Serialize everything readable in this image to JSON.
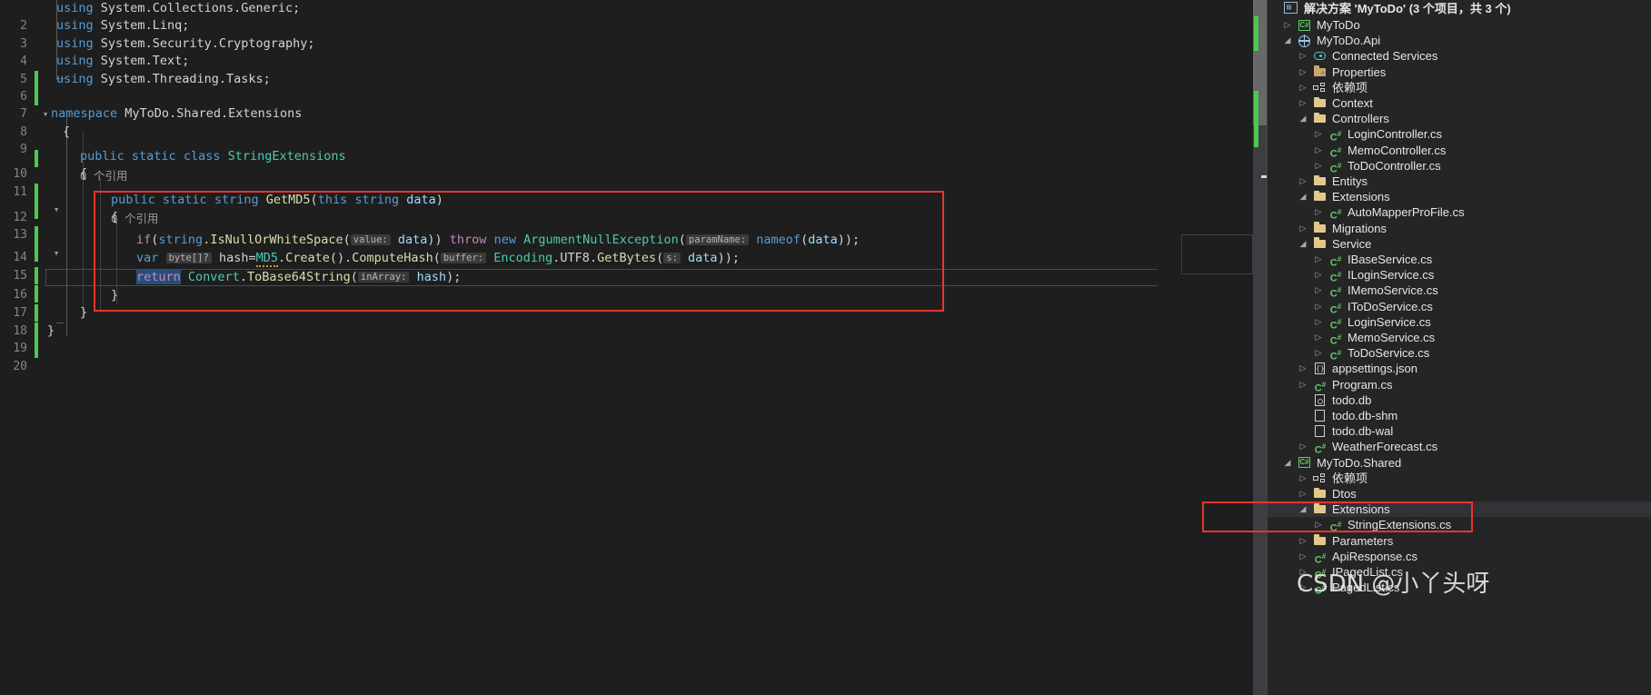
{
  "editor": {
    "first_line_number": 2,
    "lines": [
      {
        "n": 2,
        "changed": false,
        "text": "using System.Collections.Generic;"
      },
      {
        "n": 3,
        "changed": false,
        "text": "using System.Linq;"
      },
      {
        "n": 4,
        "changed": true,
        "text": "using System.Security.Cryptography;"
      },
      {
        "n": 5,
        "changed": true,
        "text": "using System.Text;"
      },
      {
        "n": 6,
        "changed": false,
        "text": "using System.Threading.Tasks;"
      },
      {
        "n": 7,
        "changed": false,
        "text": ""
      },
      {
        "n": 8,
        "changed": false,
        "text": "namespace MyToDo.Shared.Extensions"
      },
      {
        "n": 9,
        "changed": false,
        "text": "{"
      },
      {
        "n": "",
        "changed": true,
        "text": "0 个引用"
      },
      {
        "n": 10,
        "changed": true,
        "text": "public static class StringExtensions"
      },
      {
        "n": 11,
        "changed": true,
        "text": "{"
      },
      {
        "n": "",
        "changed": true,
        "text": "0 个引用"
      },
      {
        "n": 12,
        "changed": true,
        "text": "public static string GetMD5(this string data)"
      },
      {
        "n": 13,
        "changed": true,
        "text": "{"
      },
      {
        "n": 14,
        "changed": true,
        "text": "if(string.IsNullOrWhiteSpace(value: data)) throw new ArgumentNullException(paramName: nameof(data));"
      },
      {
        "n": 15,
        "changed": true,
        "text": "var byte[]? hash=MD5.Create().ComputeHash(buffer: Encoding.UTF8.GetBytes(s: data));"
      },
      {
        "n": 16,
        "changed": true,
        "text": "return Convert.ToBase64String(inArray: hash);"
      },
      {
        "n": 17,
        "changed": true,
        "text": "}"
      },
      {
        "n": 18,
        "changed": true,
        "text": "}"
      },
      {
        "n": 19,
        "changed": false,
        "text": "}"
      },
      {
        "n": 20,
        "changed": false,
        "text": ""
      }
    ],
    "reference_hint": "0 个引用",
    "current_line": 16,
    "selected_token": "return",
    "inline_hints": [
      "value:",
      "paramName:",
      "buffer:",
      "s:",
      "inArray:"
    ],
    "nullable_type_hint": "byte[]?",
    "red_highlight": "GetMD5 method body"
  },
  "explorer": {
    "solution_title": "解决方案 'MyToDo' (3 个项目，共 3 个)",
    "solution_icon": "solution-icon",
    "tree": [
      {
        "indent": 0,
        "arrow": "closed",
        "icon": "csproj",
        "label": "MyToDo"
      },
      {
        "indent": 0,
        "arrow": "open",
        "icon": "web",
        "label": "MyToDo.Api"
      },
      {
        "indent": 1,
        "arrow": "closed",
        "icon": "cloud",
        "label": "Connected Services"
      },
      {
        "indent": 1,
        "arrow": "closed",
        "icon": "props",
        "label": "Properties"
      },
      {
        "indent": 1,
        "arrow": "closed",
        "icon": "deps",
        "label": "依赖项"
      },
      {
        "indent": 1,
        "arrow": "closed",
        "icon": "folder",
        "label": "Context"
      },
      {
        "indent": 1,
        "arrow": "open",
        "icon": "folder",
        "label": "Controllers"
      },
      {
        "indent": 2,
        "arrow": "closed",
        "icon": "cs",
        "label": "LoginController.cs"
      },
      {
        "indent": 2,
        "arrow": "closed",
        "icon": "cs",
        "label": "MemoController.cs"
      },
      {
        "indent": 2,
        "arrow": "closed",
        "icon": "cs",
        "label": "ToDoController.cs"
      },
      {
        "indent": 1,
        "arrow": "closed",
        "icon": "folder",
        "label": "Entitys"
      },
      {
        "indent": 1,
        "arrow": "open",
        "icon": "folder",
        "label": "Extensions"
      },
      {
        "indent": 2,
        "arrow": "closed",
        "icon": "cs",
        "label": "AutoMapperProFile.cs"
      },
      {
        "indent": 1,
        "arrow": "closed",
        "icon": "folder",
        "label": "Migrations"
      },
      {
        "indent": 1,
        "arrow": "open",
        "icon": "folder",
        "label": "Service"
      },
      {
        "indent": 2,
        "arrow": "closed",
        "icon": "cs",
        "label": "IBaseService.cs"
      },
      {
        "indent": 2,
        "arrow": "closed",
        "icon": "cs",
        "label": "ILoginService.cs"
      },
      {
        "indent": 2,
        "arrow": "closed",
        "icon": "cs",
        "label": "IMemoService.cs"
      },
      {
        "indent": 2,
        "arrow": "closed",
        "icon": "cs",
        "label": "IToDoService.cs"
      },
      {
        "indent": 2,
        "arrow": "closed",
        "icon": "cs",
        "label": "LoginService.cs"
      },
      {
        "indent": 2,
        "arrow": "closed",
        "icon": "cs",
        "label": "MemoService.cs"
      },
      {
        "indent": 2,
        "arrow": "closed",
        "icon": "cs",
        "label": "ToDoService.cs"
      },
      {
        "indent": 1,
        "arrow": "closed",
        "icon": "json",
        "label": "appsettings.json"
      },
      {
        "indent": 1,
        "arrow": "closed",
        "icon": "cs",
        "label": "Program.cs"
      },
      {
        "indent": 1,
        "arrow": "none",
        "icon": "db",
        "label": "todo.db"
      },
      {
        "indent": 1,
        "arrow": "none",
        "icon": "file",
        "label": "todo.db-shm"
      },
      {
        "indent": 1,
        "arrow": "none",
        "icon": "file",
        "label": "todo.db-wal"
      },
      {
        "indent": 1,
        "arrow": "closed",
        "icon": "cs",
        "label": "WeatherForecast.cs"
      },
      {
        "indent": 0,
        "arrow": "open",
        "icon": "csproj",
        "label": "MyToDo.Shared"
      },
      {
        "indent": 1,
        "arrow": "closed",
        "icon": "deps",
        "label": "依赖项"
      },
      {
        "indent": 1,
        "arrow": "closed",
        "icon": "folder",
        "label": "Dtos"
      },
      {
        "indent": 1,
        "arrow": "open",
        "icon": "folder",
        "label": "Extensions",
        "highlight": true
      },
      {
        "indent": 2,
        "arrow": "closed",
        "icon": "cs",
        "label": "StringExtensions.cs"
      },
      {
        "indent": 1,
        "arrow": "closed",
        "icon": "folder",
        "label": "Parameters"
      },
      {
        "indent": 1,
        "arrow": "closed",
        "icon": "cs",
        "label": "ApiResponse.cs"
      },
      {
        "indent": 1,
        "arrow": "closed",
        "icon": "cs",
        "label": "IPagedList.cs"
      },
      {
        "indent": 1,
        "arrow": "closed",
        "icon": "cs",
        "label": "PagedList.cs"
      }
    ],
    "red_highlight_items": [
      "Extensions",
      "StringExtensions.cs"
    ]
  },
  "watermark": {
    "text": "CSDN @小丫头呀"
  },
  "colors": {
    "editor_bg": "#1e1e1e",
    "explorer_bg": "#252526",
    "keyword": "#569cd6",
    "control_keyword": "#c586c0",
    "type": "#4ec9b0",
    "method": "#dcdcaa",
    "parameter": "#9cdcfe",
    "comment_gray": "#9a9a9a",
    "changed_marker": "#4ec94e",
    "red_box": "#e8352e",
    "selection": "#264f78"
  }
}
